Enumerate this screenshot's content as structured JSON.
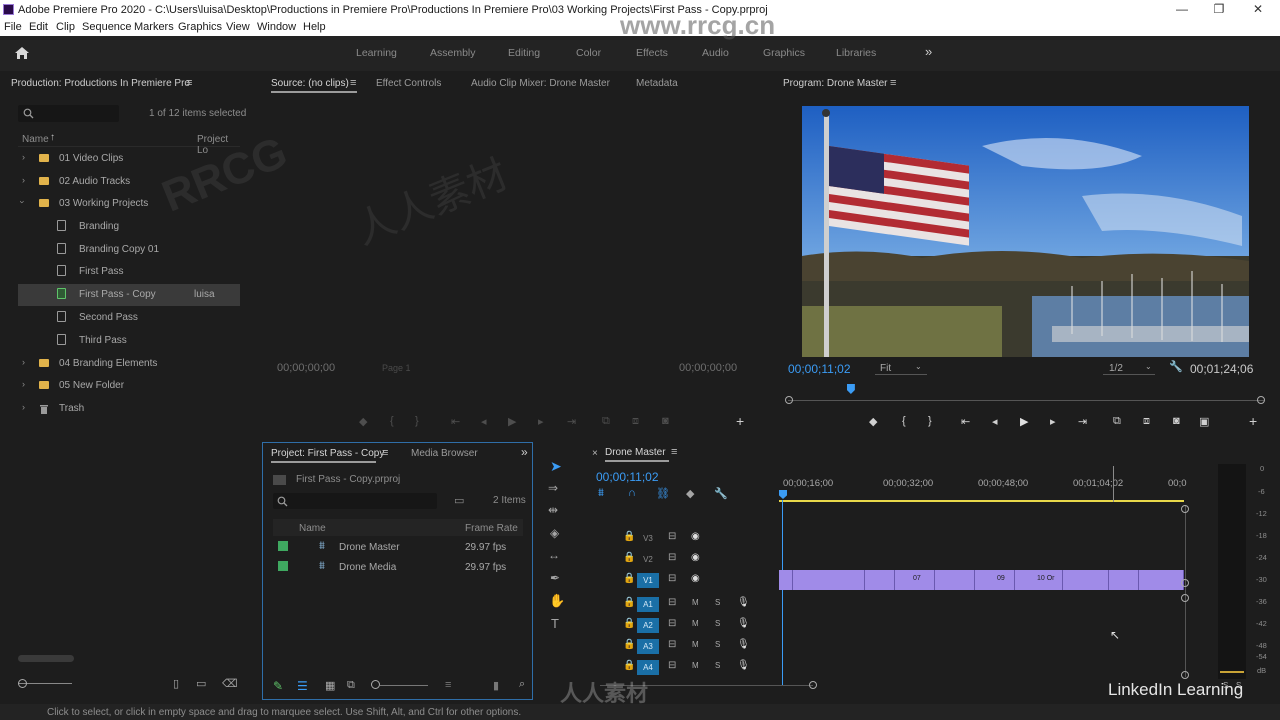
{
  "titlebar": {
    "title": "Adobe Premiere Pro 2020 - C:\\Users\\luisa\\Desktop\\Productions in Premiere Pro\\Productions In Premiere Pro\\03 Working Projects\\First Pass - Copy.prproj",
    "minimize": "—",
    "maximize": "❐",
    "close": "✕"
  },
  "menu": [
    "File",
    "Edit",
    "Clip",
    "Sequence",
    "Markers",
    "Graphics",
    "View",
    "Window",
    "Help"
  ],
  "workspaces": [
    "Learning",
    "Assembly",
    "Editing",
    "Color",
    "Effects",
    "Audio",
    "Graphics",
    "Libraries"
  ],
  "workspace_more": "»",
  "production": {
    "title": "Production: Productions In Premiere Pro",
    "items_selected": "1 of 12 items selected",
    "col_name": "Name",
    "col_project": "Project Lo",
    "items": [
      {
        "label": "01 Video Clips",
        "type": "folder"
      },
      {
        "label": "02 Audio Tracks",
        "type": "folder"
      },
      {
        "label": "03 Working Projects",
        "type": "folder"
      },
      {
        "label": "Branding",
        "type": "doc"
      },
      {
        "label": "Branding Copy 01",
        "type": "doc"
      },
      {
        "label": "First Pass",
        "type": "doc"
      },
      {
        "label": "First Pass - Copy",
        "type": "doc",
        "owner": "luisa"
      },
      {
        "label": "Second Pass",
        "type": "doc"
      },
      {
        "label": "Third Pass",
        "type": "doc"
      },
      {
        "label": "04 Branding Elements",
        "type": "folder"
      },
      {
        "label": "05 New Folder",
        "type": "folder"
      },
      {
        "label": "Trash",
        "type": "trash"
      }
    ]
  },
  "source": {
    "tabs": [
      "Source: (no clips)",
      "Effect Controls",
      "Audio Clip Mixer: Drone Master",
      "Metadata"
    ],
    "tc_left": "00;00;00;00",
    "tc_right": "00;00;00;00",
    "page": "Page 1"
  },
  "program": {
    "title": "Program: Drone Master",
    "timecode": "00;00;11;02",
    "fit": "Fit",
    "resolution": "1/2",
    "duration": "00;01;24;06",
    "playhead_fraction": 0.13
  },
  "project": {
    "tab_active": "Project: First Pass - Copy",
    "tab_other": "Media Browser",
    "file": "First Pass - Copy.prproj",
    "count": "2 Items",
    "col_name": "Name",
    "col_rate": "Frame Rate",
    "rows": [
      {
        "name": "Drone Master",
        "rate": "29.97 fps"
      },
      {
        "name": "Drone Media",
        "rate": "29.97 fps"
      }
    ]
  },
  "timeline": {
    "title": "Drone Master",
    "timecode": "00;00;11;02",
    "ruler": [
      "00;00;16;00",
      "00;00;32;00",
      "00;00;48;00",
      "00;01;04;02",
      "00;0"
    ],
    "video_tracks": [
      "V3",
      "V2",
      "V1"
    ],
    "audio_tracks": [
      "A1",
      "A2",
      "A3",
      "A4"
    ],
    "clip_labels": [
      "07",
      "09",
      "10 Or"
    ],
    "track_m": "M",
    "track_s": "S"
  },
  "meter": {
    "labels": [
      "0",
      "-6",
      "-12",
      "-18",
      "-24",
      "-30",
      "-36",
      "-42",
      "-48",
      "-54",
      "dB"
    ],
    "solo_left": "S",
    "solo_right": "S"
  },
  "watermark": {
    "brand": "LinkedIn Learning",
    "site": "www.rrcg.cn",
    "mark": "RRCG",
    "cn": "人人素材"
  },
  "status": "Click to select, or click in empty space and drag to marquee select. Use Shift, Alt, and Ctrl for other options.",
  "colors": {
    "accent": "#3b9cf5",
    "clip": "#a08be8",
    "track_on": "#1a6fa6",
    "folder": "#e1b34b",
    "work_area": "#e8d84a"
  }
}
